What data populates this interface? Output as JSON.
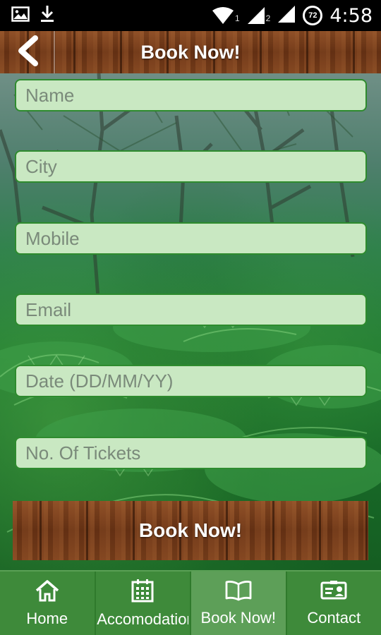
{
  "status_bar": {
    "time": "4:58",
    "battery_level": "72",
    "sim1_label": "1",
    "sim2_label": "2",
    "icons": [
      "image-icon",
      "download-icon",
      "wifi-icon",
      "signal-icon",
      "signal-icon",
      "battery-icon"
    ]
  },
  "header": {
    "title": "Book Now!",
    "back_icon": "chevron-left-icon"
  },
  "form": {
    "name_placeholder": "Name",
    "city_placeholder": "City",
    "mobile_placeholder": "Mobile",
    "email_placeholder": "Email",
    "date_placeholder": "Date (DD/MM/YY)",
    "tickets_placeholder": "No. Of Tickets",
    "submit_label": "Book Now!"
  },
  "bottom_nav": {
    "items": [
      {
        "label": "Home",
        "icon": "home-icon"
      },
      {
        "label": "Accomodation",
        "icon": "calendar-icon"
      },
      {
        "label": "Book Now!",
        "icon": "book-icon",
        "active": true
      },
      {
        "label": "Contact",
        "icon": "contact-card-icon"
      }
    ]
  },
  "colors": {
    "wood": "#7a3e1b",
    "field_bg": "#c9e8c2",
    "field_border": "#2e8b2e",
    "nav_bg": "#3e8a3a",
    "nav_active": "#5d9f58"
  }
}
